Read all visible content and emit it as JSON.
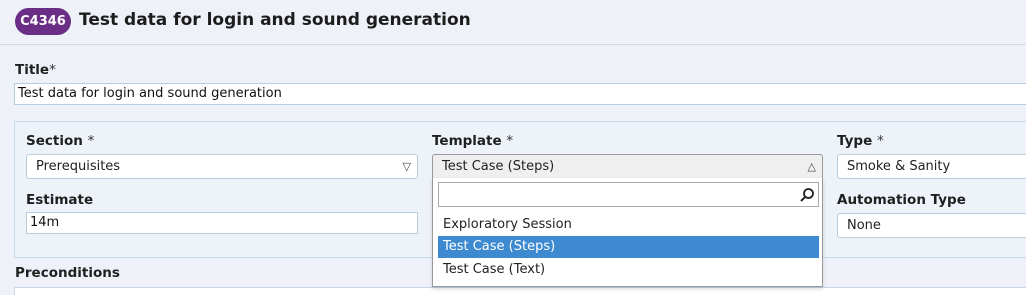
{
  "header": {
    "case_id": "C4346",
    "title": "Test data for login and sound generation"
  },
  "form": {
    "title_label": "Title",
    "title_value": "Test data for login and sound generation",
    "required_mark": "*",
    "section_label": "Section",
    "section_value": "Prerequisites",
    "template_label": "Template",
    "template_value": "Test Case (Steps)",
    "type_label": "Type",
    "type_value": "Smoke & Sanity",
    "estimate_label": "Estimate",
    "estimate_value": "14m",
    "automation_label": "Automation Type",
    "automation_value": "None",
    "preconditions_label": "Preconditions"
  },
  "template_dropdown": {
    "search_value": "",
    "options": [
      "Exploratory Session",
      "Test Case (Steps)",
      "Test Case (Text)"
    ],
    "selected_index": 1
  },
  "colors": {
    "badge": "#6a2e86",
    "selected_option": "#3d8ad0",
    "background": "#eef2f8"
  }
}
